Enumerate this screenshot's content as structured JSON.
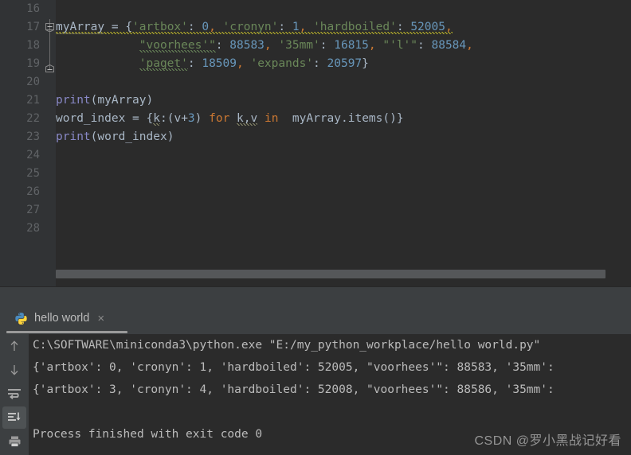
{
  "editor": {
    "first_line_number": 16,
    "line_numbers": [
      16,
      17,
      18,
      19,
      20,
      21,
      22,
      23,
      24,
      25,
      26,
      27,
      28
    ],
    "fold_markers": [
      {
        "line": 17,
        "type": "fold-collapse-icon"
      },
      {
        "line": 19,
        "type": "fold-end-icon"
      }
    ],
    "lines": {
      "l16": "",
      "l17_var": "myArray",
      "l17_eq": " = ",
      "l17_brace": "{",
      "l17_k1": "'artbox'",
      "l17_c1": ": ",
      "l17_v1": "0",
      "l17_sep1": ",",
      "l17_k2": " 'cronyn'",
      "l17_c2": ": ",
      "l17_v2": "1",
      "l17_sep2": ",",
      "l17_k3": " 'hardboiled'",
      "l17_c3": ": ",
      "l17_v3": "52005",
      "l17_sep3": ",",
      "l18_indent": "            ",
      "l18_k1": "\"voorhees'\"",
      "l18_c1": ": ",
      "l18_v1": "88583",
      "l18_sep1": ",",
      "l18_k2": " '35mm'",
      "l18_c2": ": ",
      "l18_v2": "16815",
      "l18_sep2": ",",
      "l18_k3": " \"'l'\"",
      "l18_c3": ": ",
      "l18_v3": "88584",
      "l18_sep3": ",",
      "l19_indent": "            ",
      "l19_k1": "'paget'",
      "l19_c1": ": ",
      "l19_v1": "18509",
      "l19_sep1": ",",
      "l19_k2": " 'expands'",
      "l19_c2": ": ",
      "l19_v2": "20597",
      "l19_close": "}",
      "l21_fn": "print",
      "l21_open": "(",
      "l21_arg": "myArray",
      "l21_close": ")",
      "l22_var": "word_index",
      "l22_eq": " = ",
      "l22_open": "{",
      "l22_k": "k",
      "l22_colon": ":",
      "l22_expr_open": "(",
      "l22_v": "v",
      "l22_plus": "+",
      "l22_three": "3",
      "l22_expr_close": ")",
      "l22_for": " for ",
      "l22_kv": "k,v",
      "l22_in": " in ",
      "l22_iter": " myArray.items()",
      "l22_close": "}",
      "l23_fn": "print",
      "l23_open": "(",
      "l23_arg": "word_index",
      "l23_close": ")"
    }
  },
  "run_panel": {
    "tab": {
      "label": "hello world",
      "icon": "python-logo-icon",
      "close_label": "×"
    },
    "toolbar": [
      {
        "name": "rerun-up-arrow-icon",
        "label": "↑",
        "active": false
      },
      {
        "name": "rerun-down-arrow-icon",
        "label": "↓",
        "active": false
      },
      {
        "name": "soft-wrap-icon",
        "label": "soft-wrap",
        "active": false
      },
      {
        "name": "scroll-to-end-icon",
        "label": "scroll-to-end",
        "active": true
      },
      {
        "name": "print-icon",
        "label": "print",
        "active": false
      }
    ],
    "console_lines": [
      "C:\\SOFTWARE\\miniconda3\\python.exe \"E:/my_python_workplace/hello world.py\"",
      "{'artbox': 0, 'cronyn': 1, 'hardboiled': 52005, \"voorhees'\": 88583, '35mm':",
      "{'artbox': 3, 'cronyn': 4, 'hardboiled': 52008, \"voorhees'\": 88586, '35mm':",
      "",
      "Process finished with exit code 0"
    ]
  },
  "watermark": {
    "text": "CSDN @罗小黑战记好看"
  },
  "colors": {
    "editor_bg": "#2b2b2b",
    "gutter_bg": "#313335",
    "panel_bg": "#3c3f41",
    "string": "#6a8759",
    "number": "#6897bb",
    "keyword": "#cc7832",
    "default_text": "#a9b7c6",
    "console_text": "#bbbbbb",
    "line_number": "#606366"
  }
}
